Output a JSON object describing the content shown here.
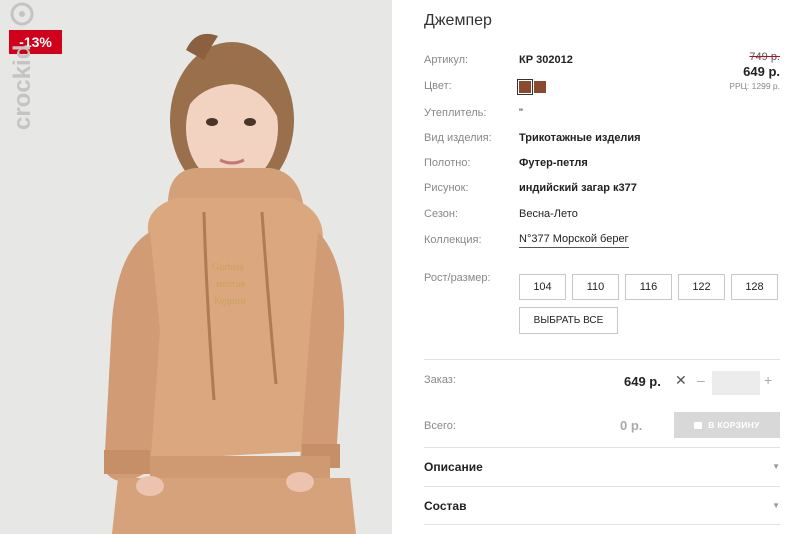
{
  "photo": {
    "discount_badge": "-13%",
    "brand": "crockid",
    "print_lines": [
      "Gurbsia",
      "мечтая",
      "Кудини"
    ]
  },
  "product": {
    "title": "Джемпер",
    "article_label": "Артикул:",
    "article_value": "КР 302012",
    "color_label": "Цвет:",
    "colors": [
      "#8b4a2e",
      "#8b4a2e"
    ],
    "insulation_label": "Утеплитель:",
    "insulation_value": "\"",
    "type_label": "Вид изделия:",
    "type_value": "Трикотажные изделия",
    "fabric_label": "Полотно:",
    "fabric_value": "Футер-петля",
    "pattern_label": "Рисунок:",
    "pattern_value": "индийский загар к377",
    "season_label": "Сезон:",
    "season_value": "Весна-Лето",
    "collection_label": "Коллекция:",
    "collection_value": "N°377 Морской берег"
  },
  "price": {
    "old": "749 р.",
    "current": "649 р.",
    "rrp": "РРЦ: 1299 р."
  },
  "sizes": {
    "label": "Рост/размер:",
    "options": [
      "104",
      "110",
      "116",
      "122",
      "128"
    ],
    "select_all": "ВЫБРАТЬ ВСЕ"
  },
  "order": {
    "label": "Заказ:",
    "price": "649 р.",
    "times": "✕",
    "minus": "–",
    "plus": "+",
    "quantity": ""
  },
  "total": {
    "label": "Всего:",
    "value": "0 р.",
    "cart_button": "В КОРЗИНУ"
  },
  "accordion": {
    "description": "Описание",
    "composition": "Состав"
  },
  "colors": {
    "accent_red": "#d0021b",
    "hoodie": "#d9a47d",
    "disabled": "#d8d8d8"
  }
}
